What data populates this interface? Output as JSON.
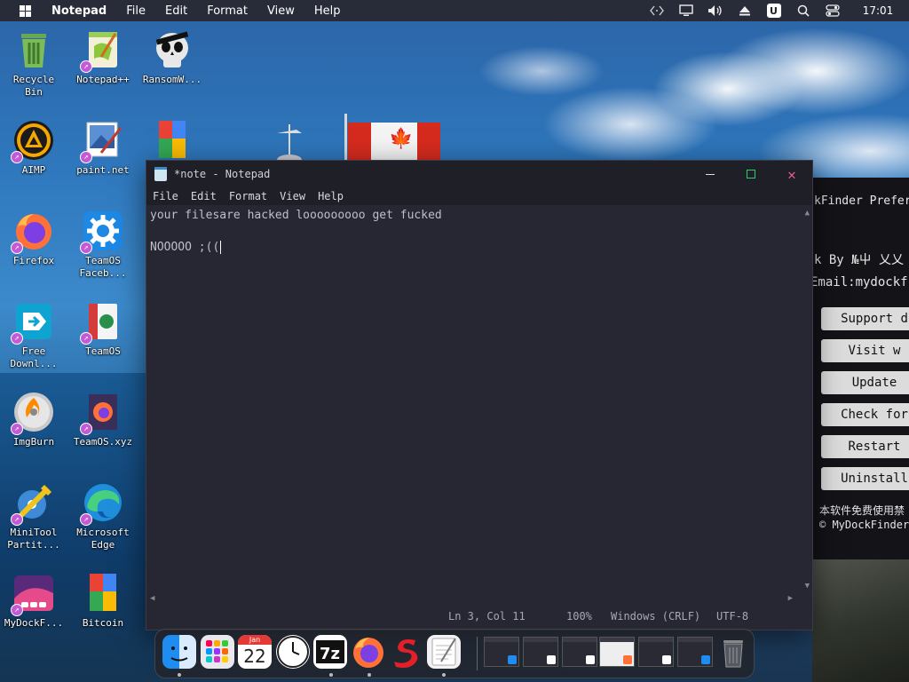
{
  "topbar": {
    "app": "Notepad",
    "menus": [
      "File",
      "Edit",
      "Format",
      "View",
      "Help"
    ],
    "tray_icons": [
      "code-icon",
      "monitor-icon",
      "volume-icon",
      "eject-icon",
      "user-icon",
      "search-icon",
      "control-center-icon"
    ],
    "user_badge": "U",
    "clock": "17:01"
  },
  "desktop": {
    "icons": [
      {
        "label": "Recycle\nBin",
        "icon": "recycle-bin-icon",
        "shortcut": false
      },
      {
        "label": "Notepad++",
        "icon": "notepadpp-icon",
        "shortcut": true
      },
      {
        "label": "RansomW...",
        "icon": "ransom-skull-icon",
        "shortcut": false
      },
      {
        "label": "AIMP",
        "icon": "aimp-icon",
        "shortcut": true
      },
      {
        "label": "paint.net",
        "icon": "paintnet-icon",
        "shortcut": true
      },
      {
        "label": "",
        "icon": "google-docs-icon",
        "shortcut": false
      },
      {
        "label": "Firefox",
        "icon": "firefox-icon",
        "shortcut": true
      },
      {
        "label": "TeamOS\nFaceb...",
        "icon": "gear-icon",
        "shortcut": true
      },
      {
        "label": "Free\nDownl...",
        "icon": "free-download-icon",
        "shortcut": true
      },
      {
        "label": "TeamOS",
        "icon": "teamos-icon",
        "shortcut": true
      },
      {
        "label": "ImgBurn",
        "icon": "imgburn-icon",
        "shortcut": true
      },
      {
        "label": "TeamOS.xyz",
        "icon": "teamos-xyz-icon",
        "shortcut": true
      },
      {
        "label": "MiniTool\nPartit...",
        "icon": "minitool-icon",
        "shortcut": true
      },
      {
        "label": "Microsoft\nEdge",
        "icon": "edge-icon",
        "shortcut": true
      },
      {
        "label": "MyDockF...",
        "icon": "mydockfinder-icon",
        "shortcut": true
      },
      {
        "label": "Bitcoin",
        "icon": "bitcoin-doc-icon",
        "shortcut": false
      }
    ]
  },
  "notepad": {
    "title": "*note - Notepad",
    "menus": [
      "File",
      "Edit",
      "Format",
      "View",
      "Help"
    ],
    "lines": [
      "your filesare hacked looooooooo get fucked",
      "",
      "NOOOOO ;(("
    ],
    "status": {
      "position": "Ln 3, Col 11",
      "zoom": "100%",
      "line_ending": "Windows (CRLF)",
      "encoding": "UTF-8"
    }
  },
  "prefs": {
    "title": "kFinder Prefer",
    "author": "k By №屮 乂乂",
    "email": "Email:mydockf",
    "buttons": [
      "Support d",
      "Visit w",
      "Update",
      "Check for",
      "Restart",
      "Uninstall"
    ],
    "note": "本软件免费使用禁",
    "copyright": "© MyDockFinder"
  },
  "dock": {
    "calendar_month": "Jan",
    "calendar_day": "22",
    "apps": [
      "finder-icon",
      "launchpad-icon",
      "calendar-icon",
      "clock-icon",
      "7zip-icon",
      "firefox-icon",
      "s-app-icon",
      "notepad-icon"
    ],
    "thumbnails": 6
  },
  "colors": {
    "notepad_bg": "#272733",
    "notepad_chrome": "#1f1f27",
    "maximize": "#2ecc71",
    "close": "#e35d8a"
  }
}
